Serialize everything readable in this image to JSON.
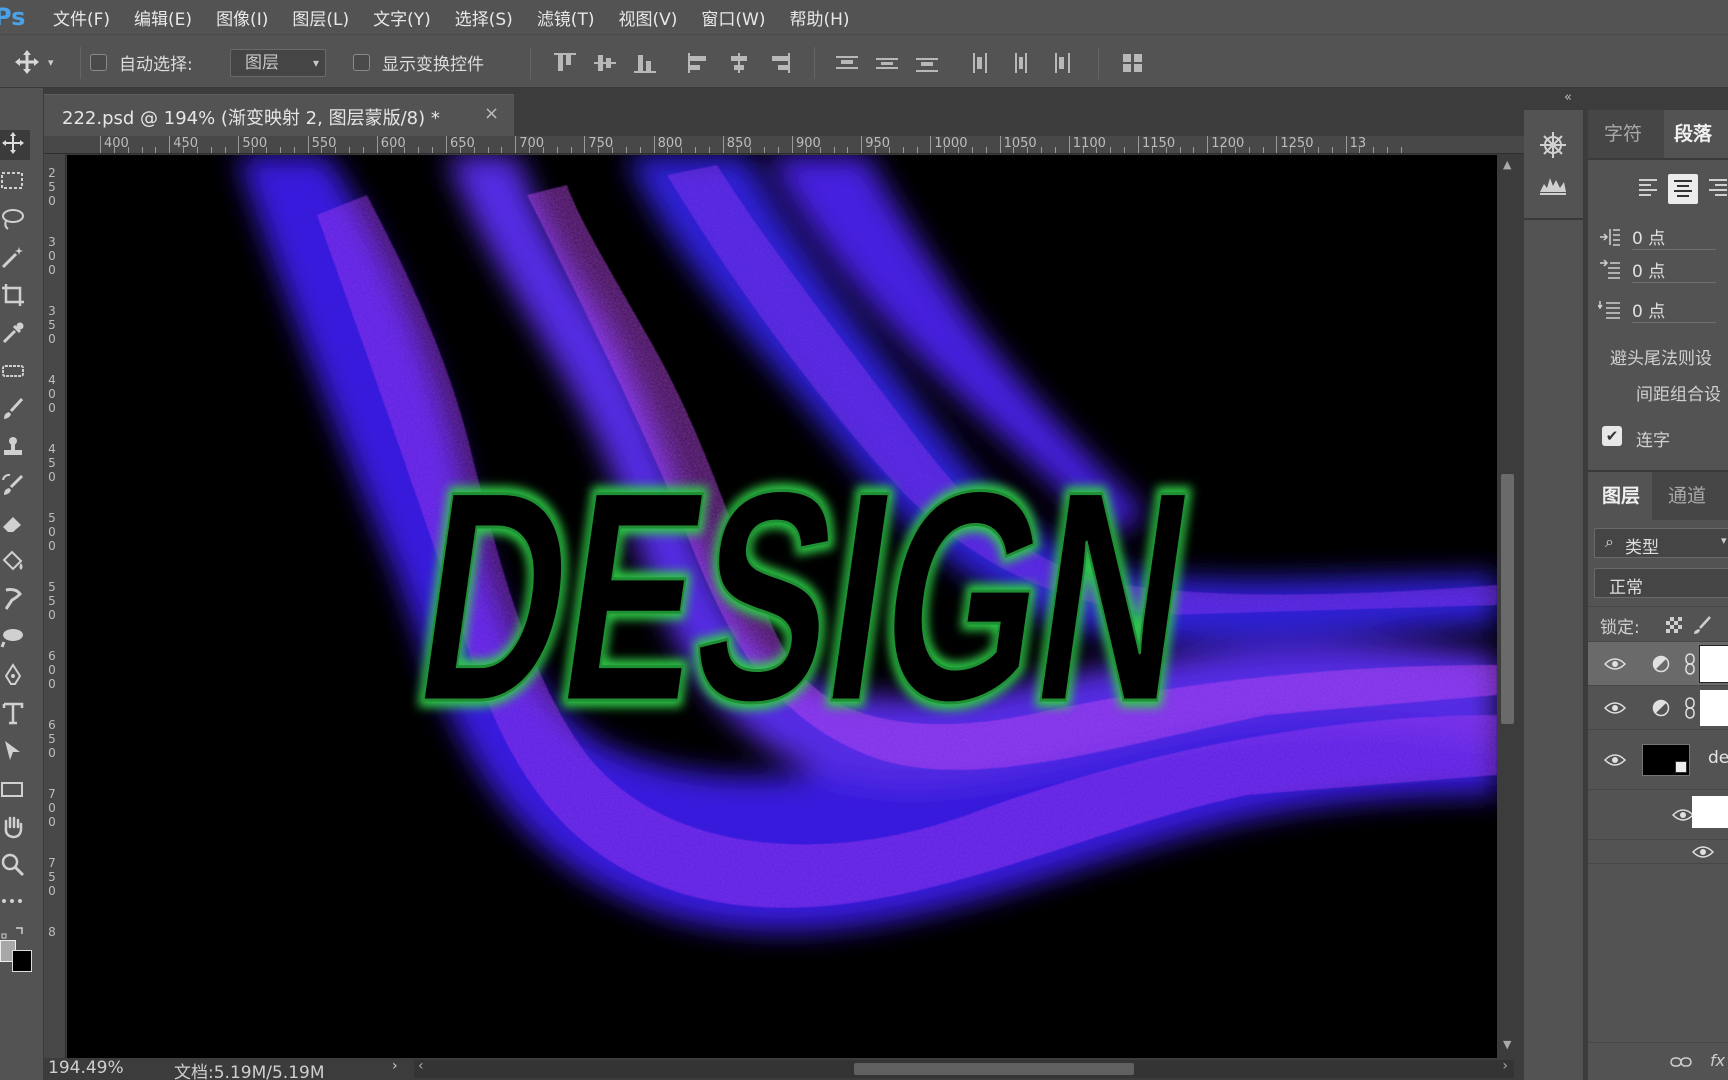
{
  "menubar": {
    "logo": "Ps",
    "items": [
      "文件(F)",
      "编辑(E)",
      "图像(I)",
      "图层(L)",
      "文字(Y)",
      "选择(S)",
      "滤镜(T)",
      "视图(V)",
      "窗口(W)",
      "帮助(H)"
    ]
  },
  "options": {
    "auto_select_label": "自动选择:",
    "auto_select_checked": false,
    "layer_select_value": "图层",
    "show_transform_label": "显示变换控件",
    "show_transform_checked": false
  },
  "document": {
    "tab_title": "222.psd @ 194% (渐变映射 2, 图层蒙版/8) *",
    "close_glyph": "×"
  },
  "rulers": {
    "top": [
      "400",
      "450",
      "500",
      "550",
      "600",
      "650",
      "700",
      "750",
      "800",
      "850",
      "900",
      "950",
      "1000",
      "1050",
      "1100",
      "1150",
      "1200",
      "1250",
      "13"
    ],
    "left": [
      "250",
      "300",
      "350",
      "400",
      "450",
      "500",
      "550",
      "600",
      "650",
      "700",
      "750",
      "8"
    ]
  },
  "canvas": {
    "artwork_text": "DESIGN",
    "colors": {
      "background": "#000000",
      "flow_primary": "#3b1fe8",
      "flow_secondary": "#a23cf0",
      "glow": "#2fcf47"
    }
  },
  "status": {
    "zoom": "194.49%",
    "doc_size": "文档:5.19M/5.19M"
  },
  "character_panel": {
    "tabs": [
      "字符",
      "段落"
    ],
    "active_tab": "段落",
    "indent_left": "0 点",
    "indent_first": "0 点",
    "space_before": "0 点",
    "kinsoku_label": "避头尾法则设",
    "mojikumi_label": "间距组合设",
    "hyphenate_label": "连字",
    "hyphenate_checked": true
  },
  "layers_panel": {
    "tabs": [
      "图层",
      "通道"
    ],
    "active_tab": "图层",
    "filter_label": "类型",
    "blend_mode": "正常",
    "lock_label": "锁定:",
    "layer_name_partial": "de"
  }
}
